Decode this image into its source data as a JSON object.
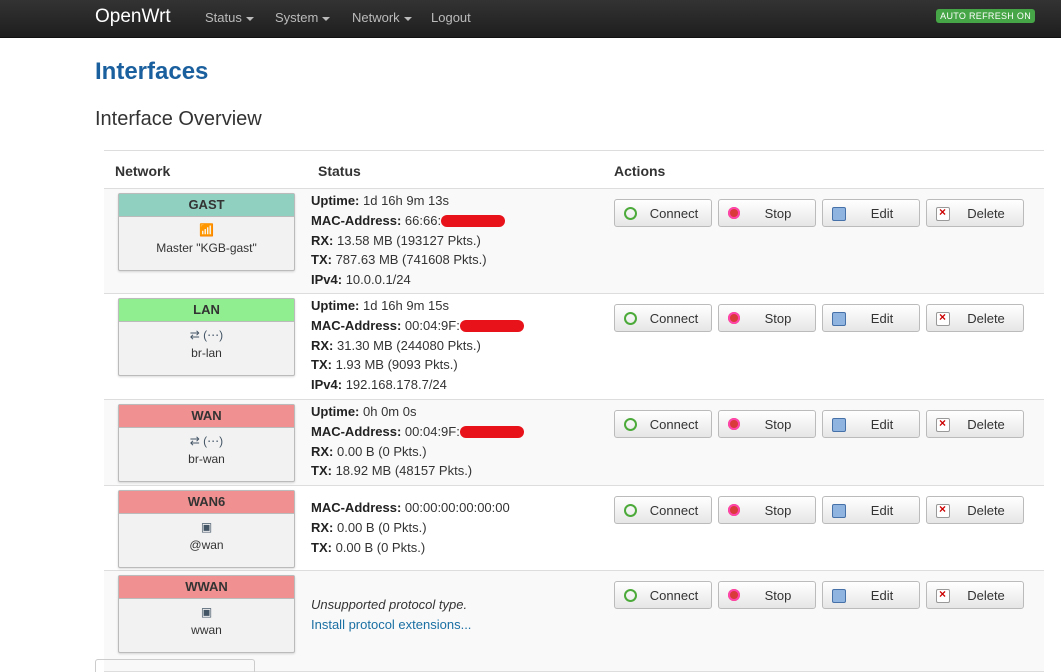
{
  "nav": {
    "brand": "OpenWrt",
    "menus": [
      "Status",
      "System",
      "Network",
      "Logout"
    ],
    "auto_refresh": "AUTO REFRESH ON"
  },
  "page": {
    "title": "Interfaces",
    "section": "Interface Overview"
  },
  "table": {
    "headers": [
      "Network",
      "Status",
      "Actions"
    ],
    "actions": [
      "Connect",
      "Stop",
      "Edit",
      "Delete"
    ],
    "rows": [
      {
        "name": "GAST",
        "color": "#90d0c0",
        "icons": "wifi",
        "desc": "Master \"KGB-gast\"",
        "lines": [
          {
            "k": "Uptime:",
            "v": " 1d 16h 9m 13s"
          },
          {
            "k": "MAC-Address:",
            "v": " 66:66:"
          },
          {
            "k": "RX:",
            "v": " 13.58 MB (193127 Pkts.)"
          },
          {
            "k": "TX:",
            "v": " 787.63 MB (741608 Pkts.)"
          },
          {
            "k": "IPv4:",
            "v": " 10.0.0.1/24"
          }
        ]
      },
      {
        "name": "LAN",
        "color": "#90ee90",
        "icons": "bridge",
        "desc": "br-lan",
        "lines": [
          {
            "k": "Uptime:",
            "v": " 1d 16h 9m 15s"
          },
          {
            "k": "MAC-Address:",
            "v": " 00:04:9F:"
          },
          {
            "k": "RX:",
            "v": " 31.30 MB (244080 Pkts.)"
          },
          {
            "k": "TX:",
            "v": " 1.93 MB (9093 Pkts.)"
          },
          {
            "k": "IPv4:",
            "v": " 192.168.178.7/24"
          }
        ]
      },
      {
        "name": "WAN",
        "color": "#f09090",
        "icons": "bridge",
        "desc": "br-wan",
        "lines": [
          {
            "k": "Uptime:",
            "v": " 0h 0m 0s"
          },
          {
            "k": "MAC-Address:",
            "v": " 00:04:9F:"
          },
          {
            "k": "RX:",
            "v": " 0.00 B (0 Pkts.)"
          },
          {
            "k": "TX:",
            "v": " 18.92 MB (48157 Pkts.)"
          }
        ]
      },
      {
        "name": "WAN6",
        "color": "#f09090",
        "icons": "alias",
        "desc": "@wan",
        "lines": [
          {
            "k": "MAC-Address:",
            "v": " 00:00:00:00:00:00"
          },
          {
            "k": "RX:",
            "v": " 0.00 B (0 Pkts.)"
          },
          {
            "k": "TX:",
            "v": " 0.00 B (0 Pkts.)"
          }
        ]
      },
      {
        "name": "WWAN",
        "color": "#f09090",
        "icons": "alias",
        "desc": "wwan",
        "unsupported": "Unsupported protocol type.",
        "install_link": "Install protocol extensions..."
      }
    ]
  }
}
